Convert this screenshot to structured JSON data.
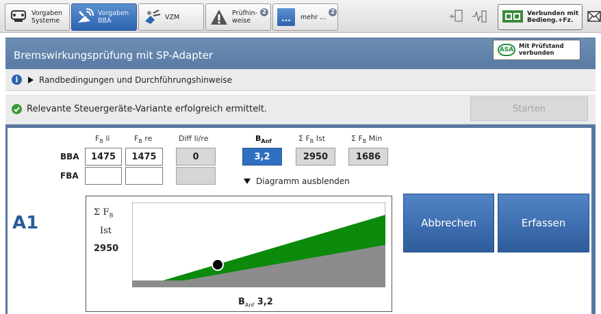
{
  "toolbar": {
    "tabs": [
      {
        "label": "Vorgaben\nSysteme",
        "icon": "car-icon"
      },
      {
        "label": "Vorgaben\nBBA",
        "icon": "satellite-icon"
      },
      {
        "label": "VZM",
        "icon": "sensor-icon"
      },
      {
        "label": "Prüfhin-\nweise",
        "icon": "warning-icon",
        "badge": "2"
      },
      {
        "label": "mehr ...",
        "icon": "more-icon",
        "badge": "2"
      }
    ],
    "connection_label": "Verbunden mit\nBedieng.+Fz."
  },
  "title": "Bremswirkungsprüfung mit SP-Adapter",
  "asa_status": "Mit Prüfstand\nverbunden",
  "info_row": "Randbedingungen und Durchführungshinweise",
  "status_message": "Relevante Steuergeräte-Variante erfolgreich ermittelt.",
  "start_button": "Starten",
  "axle_label": "A1",
  "table": {
    "headers": {
      "fb_li": "F",
      "fb_li_sub": "B",
      "fb_li_suffix": " li",
      "fb_re": "F",
      "fb_re_sub": "B",
      "fb_re_suffix": " re",
      "diff": "Diff li/re",
      "banf": "B",
      "banf_sub": "Anf",
      "sum_ist": "Σ F",
      "sum_ist_sub": "B",
      "sum_ist_suffix": " Ist",
      "sum_min": "Σ F",
      "sum_min_sub": "B",
      "sum_min_suffix": " Min"
    },
    "rows": {
      "bba": {
        "label": "BBA",
        "fb_li": "1475",
        "fb_re": "1475",
        "diff": "0"
      },
      "fba": {
        "label": "FBA",
        "fb_li": "",
        "fb_re": "",
        "diff": ""
      }
    },
    "banf_value": "3,2",
    "sum_ist_value": "2950",
    "sum_min_value": "1686"
  },
  "diagram_toggle": "Diagramm ausblenden",
  "chart": {
    "ylabel_line1": "Σ F",
    "ylabel_line1_sub": "B",
    "ylabel_line2": "Ist",
    "current_value": "2950",
    "xlabel": "B",
    "xlabel_sub": "Anf",
    "x_value": " 3,2"
  },
  "chart_data": {
    "type": "area",
    "series": [
      {
        "name": "",
        "color": "#0c8a0c"
      },
      {
        "name": "",
        "color": "#8c8c8c"
      }
    ],
    "marker": {
      "x": "3,2",
      "y": "2950"
    },
    "grid": false
  },
  "buttons": {
    "cancel": "Abbrechen",
    "capture": "Erfassen"
  },
  "colors": {
    "accent_blue": "#2f6fbf",
    "panel_frame": "#5678a0",
    "green_band": "#0c8a0c",
    "gray_band": "#8c8c8c"
  }
}
